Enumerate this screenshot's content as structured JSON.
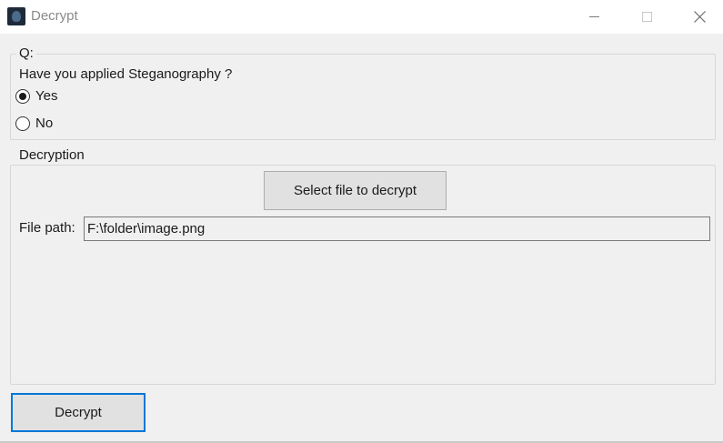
{
  "window": {
    "title": "Decrypt",
    "icon": "app-icon"
  },
  "question_group": {
    "title": "Q:",
    "question": "Have you applied Steganography ?",
    "options": [
      {
        "label": "Yes",
        "checked": true
      },
      {
        "label": "No",
        "checked": false
      }
    ]
  },
  "decryption_group": {
    "title": "Decryption",
    "select_button_label": "Select file to decrypt",
    "file_path_label": "File path:",
    "file_path_value": "F:\\folder\\image.png"
  },
  "actions": {
    "decrypt_button_label": "Decrypt"
  },
  "colors": {
    "accent": "#0078d7",
    "window_bg": "#f0f0f0",
    "button_bg": "#e1e1e1"
  }
}
